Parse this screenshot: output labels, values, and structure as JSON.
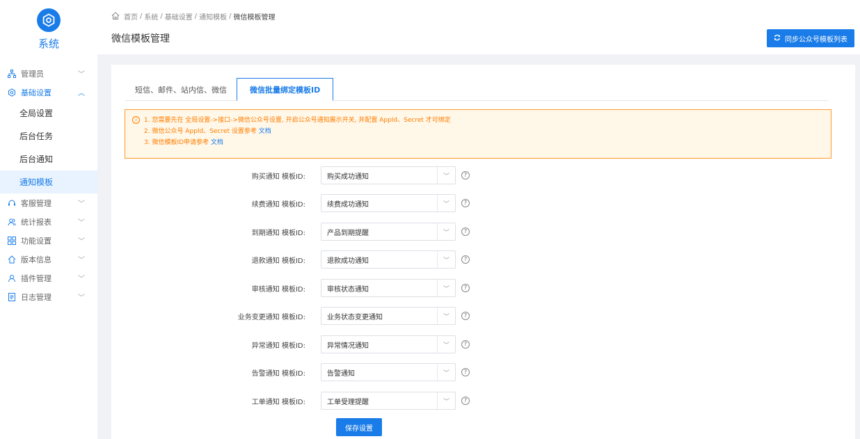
{
  "app": {
    "title": "系统"
  },
  "sidebar": {
    "items": [
      {
        "icon": "org-chart-icon",
        "label": "管理员",
        "open": false
      },
      {
        "icon": "gear-circle-icon",
        "label": "基础设置",
        "open": true,
        "children": [
          {
            "label": "全局设置",
            "active": false
          },
          {
            "label": "后台任务",
            "active": false
          },
          {
            "label": "后台通知",
            "active": false
          },
          {
            "label": "通知模板",
            "active": true
          }
        ]
      },
      {
        "icon": "headset-icon",
        "label": "客服管理",
        "open": false
      },
      {
        "icon": "users-icon",
        "label": "统计报表",
        "open": false
      },
      {
        "icon": "grid-icon",
        "label": "功能设置",
        "open": false
      },
      {
        "icon": "version-icon",
        "label": "版本信息",
        "open": false
      },
      {
        "icon": "plugin-icon",
        "label": "插件管理",
        "open": false
      },
      {
        "icon": "log-icon",
        "label": "日志管理",
        "open": false
      }
    ]
  },
  "breadcrumb": [
    "首页",
    "系统",
    "基础设置",
    "通知模板",
    "微信模板管理"
  ],
  "header": {
    "title": "微信模板管理",
    "sync_label": "同步公众号模板列表"
  },
  "tabs": [
    {
      "label": "短信、邮件、站内信、微信",
      "active": false
    },
    {
      "label": "微信批量绑定模板ID",
      "active": true
    }
  ],
  "alert": {
    "line1_prefix": "1. 您需要先在 全局设置->接口->微信公众号设置, 开启公众号通知展示开关, 并配置 AppId、Secret 才可绑定",
    "line2_prefix": "2. 微信公众号 AppId、Secret 设置参考 ",
    "line2_link": "文档",
    "line3_prefix": "3. 微信模板ID申请参考 ",
    "line3_link": "文档"
  },
  "form": {
    "rows": [
      {
        "label": "购买通知 模板ID:",
        "value": "购买成功通知"
      },
      {
        "label": "续费通知 模板ID:",
        "value": "续费成功通知"
      },
      {
        "label": "到期通知 模板ID:",
        "value": "产品到期提醒"
      },
      {
        "label": "退款通知 模板ID:",
        "value": "退款成功通知"
      },
      {
        "label": "审核通知 模板ID:",
        "value": "审核状态通知"
      },
      {
        "label": "业务变更通知 模板ID:",
        "value": "业务状态变更通知"
      },
      {
        "label": "异常通知 模板ID:",
        "value": "异常情况通知"
      },
      {
        "label": "告警通知 模板ID:",
        "value": "告警通知"
      },
      {
        "label": "工单通知 模板ID:",
        "value": "工单受理提醒"
      }
    ],
    "save_label": "保存设置"
  },
  "colors": {
    "primary": "#1a7ce8",
    "warning": "#ff7d00",
    "warning_bg": "#fff7e8"
  }
}
